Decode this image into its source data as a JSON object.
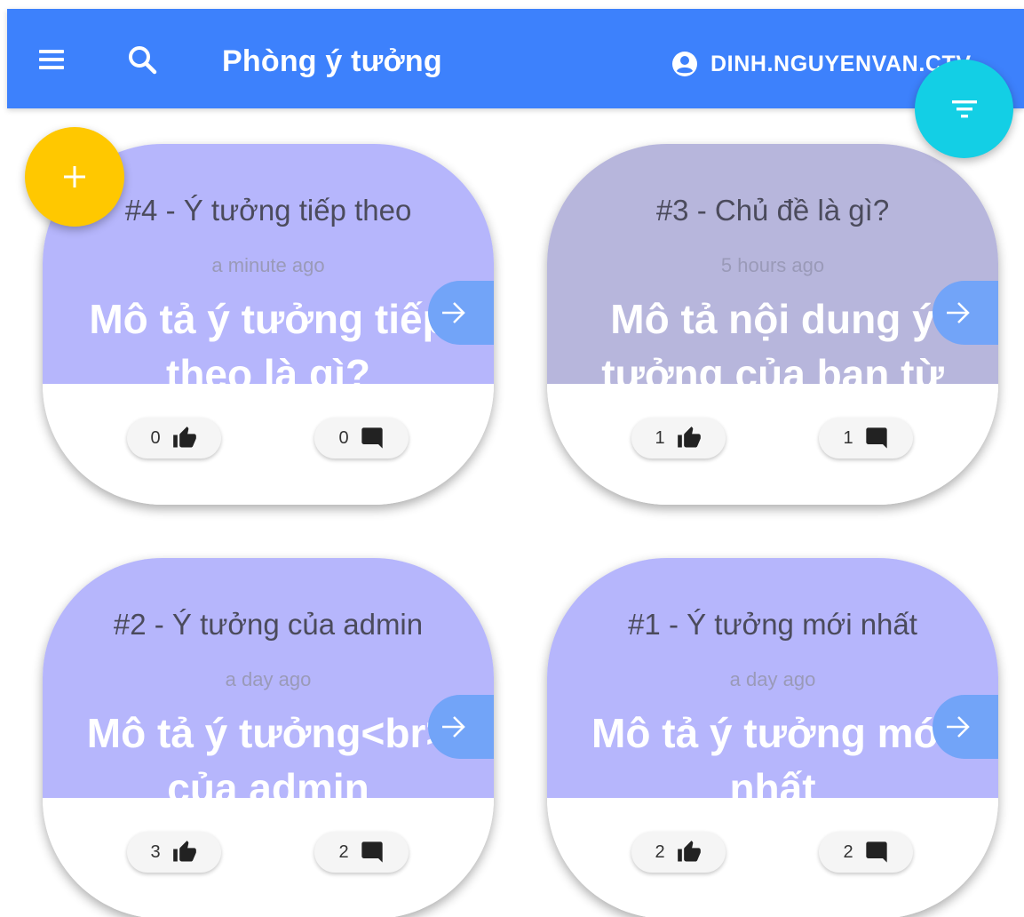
{
  "header": {
    "title": "Phòng ý tưởng",
    "user_name": "DINH.NGUYENVAN.CTV",
    "color": "#3d81fc"
  },
  "fabs": {
    "add_icon": "plus-icon",
    "add_color": "#ffc800",
    "filter_icon": "filter-icon",
    "filter_color": "#13cfe5"
  },
  "ideas": [
    {
      "title": "#4 - Ý tưởng tiếp theo",
      "time": "a minute ago",
      "description": "Mô tả ý tưởng tiếp theo là gì?",
      "likes": "0",
      "comments": "0",
      "color": "#b6b6fc"
    },
    {
      "title": "#3 - Chủ đề là gì?",
      "time": "5 hours ago",
      "description": "Mô tả nội dung ý tưởng của bạn từ",
      "likes": "1",
      "comments": "1",
      "color": "#b7b6dc"
    },
    {
      "title": "#2 - Ý tưởng của admin",
      "time": "a day ago",
      "description": "Mô tả ý tưởng<br> của admin",
      "likes": "3",
      "comments": "2",
      "color": "#b6b6fc"
    },
    {
      "title": "#1 - Ý tưởng mới nhất",
      "time": "a day ago",
      "description": "Mô tả ý tưởng mới nhất",
      "likes": "2",
      "comments": "2",
      "color": "#b6b6fc"
    }
  ]
}
